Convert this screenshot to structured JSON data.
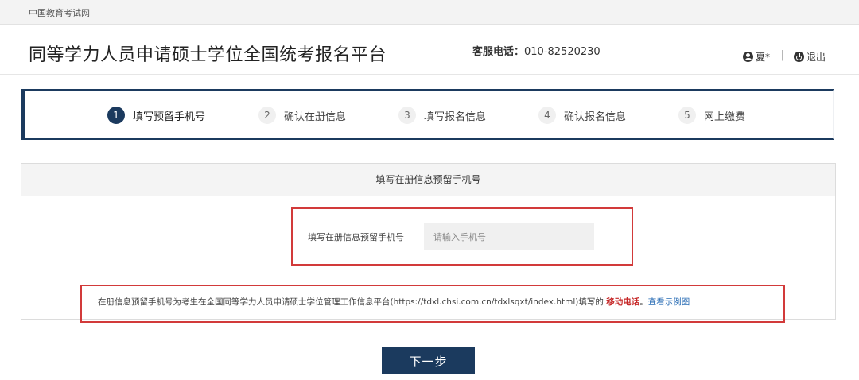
{
  "topbar": {
    "site_name": "中国教育考试网"
  },
  "header": {
    "title": "同等学力人员申请硕士学位全国统考报名平台",
    "service_label": "客服电话：",
    "service_phone": "010-82520230",
    "user_name": "夏*",
    "separator": "|",
    "logout_label": "退出"
  },
  "steps": [
    {
      "num": "1",
      "label": "填写预留手机号",
      "active": true
    },
    {
      "num": "2",
      "label": "确认在册信息"
    },
    {
      "num": "3",
      "label": "填写报名信息"
    },
    {
      "num": "4",
      "label": "确认报名信息"
    },
    {
      "num": "5",
      "label": "网上缴费"
    }
  ],
  "panel": {
    "title": "填写在册信息预留手机号",
    "field_label": "填写在册信息预留手机号",
    "phone_placeholder": "请输入手机号",
    "note_prefix": "在册信息预留手机号为考生在全国同等学力人员申请硕士学位管理工作信息平台(https://tdxl.chsi.com.cn/tdxlsqxt/index.html)填写的 ",
    "note_emphasis": "移动电话",
    "note_period": "。",
    "note_link": "查看示例图"
  },
  "actions": {
    "next_label": "下一步"
  },
  "colors": {
    "primary": "#1b3a5e",
    "highlight": "#d23a3a",
    "emphasis": "#c62828",
    "link": "#2a6db5"
  }
}
